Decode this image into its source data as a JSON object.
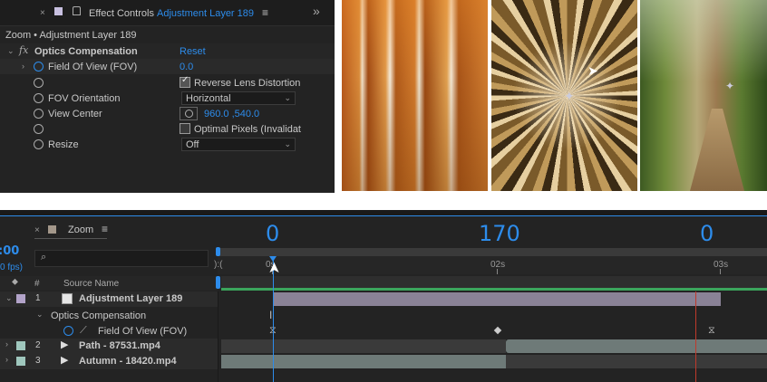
{
  "effect_controls": {
    "panel_title": "Effect Controls",
    "layer_name": "Adjustment Layer 189",
    "breadcrumb": "Zoom • Adjustment Layer 189",
    "effect_name": "Optics Compensation",
    "reset_label": "Reset",
    "fx_label": "fx",
    "properties": {
      "fov_label": "Field Of View (FOV)",
      "fov_value": "0.0",
      "reverse_lens_label": "Reverse Lens Distortion",
      "reverse_lens_checked": true,
      "fov_orientation_label": "FOV Orientation",
      "fov_orientation_value": "Horizontal",
      "view_center_label": "View Center",
      "view_center_value": "960.0 ,540.0",
      "optimal_pixels_label": "Optimal Pixels (Invalidat",
      "optimal_pixels_checked": false,
      "resize_label": "Resize",
      "resize_value": "Off"
    }
  },
  "timeline": {
    "tab_label": "Zoom",
    "timecode": ":00",
    "fps": "0 fps)",
    "search_placeholder": "",
    "value_markers": [
      "0",
      "170",
      "0"
    ],
    "ruler_labels": [
      "0s",
      "02s",
      "03s"
    ],
    "ruler_start": "):(",
    "column_headers": {
      "hash": "#",
      "source_name": "Source Name"
    },
    "layers": [
      {
        "index": "1",
        "name": "Adjustment Layer 189",
        "color": "#b2a3c9"
      },
      {
        "index": "2",
        "name": "Path - 87531.mp4",
        "color": "#9fc7bd"
      },
      {
        "index": "3",
        "name": "Autumn - 18420.mp4",
        "color": "#9fc7bd"
      }
    ],
    "effect_row": "Optics Compensation",
    "fov_row": "Field Of View (FOV)"
  },
  "colors": {
    "accent": "#2d8ceb",
    "panel_bg": "#232323",
    "playhead": "#2d8ceb",
    "end_marker": "#c0392b",
    "work_area": "#3ba55c"
  }
}
